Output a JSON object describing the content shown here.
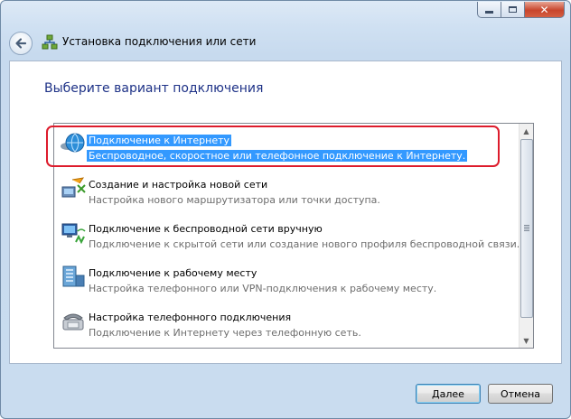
{
  "window": {
    "title": "Установка подключения или сети",
    "caption_buttons": [
      "minimize",
      "maximize",
      "close"
    ],
    "close_glyph": "✕"
  },
  "page": {
    "heading": "Выберите вариант подключения"
  },
  "options": [
    {
      "title": "Подключение к Интернету",
      "description": "Беспроводное, скоростное или телефонное подключение к Интернету.",
      "icon": "internet-globe-icon",
      "selected": true
    },
    {
      "title": "Создание и настройка новой сети",
      "description": "Настройка нового маршрутизатора или точки доступа.",
      "icon": "new-network-icon",
      "selected": false
    },
    {
      "title": "Подключение к беспроводной сети вручную",
      "description": "Подключение к скрытой сети или создание нового профиля беспроводной связи.",
      "icon": "wireless-network-icon",
      "selected": false
    },
    {
      "title": "Подключение к рабочему месту",
      "description": "Настройка телефонного или VPN-подключения к рабочему месту.",
      "icon": "workplace-building-icon",
      "selected": false
    },
    {
      "title": "Настройка телефонного подключения",
      "description": "Подключение к Интернету через телефонную сеть.",
      "icon": "telephone-icon",
      "selected": false
    }
  ],
  "buttons": {
    "next": "Далее",
    "cancel": "Отмена"
  },
  "colors": {
    "selection": "#3399ff",
    "highlight_ring": "#dd1c2c",
    "heading": "#1e3287"
  }
}
